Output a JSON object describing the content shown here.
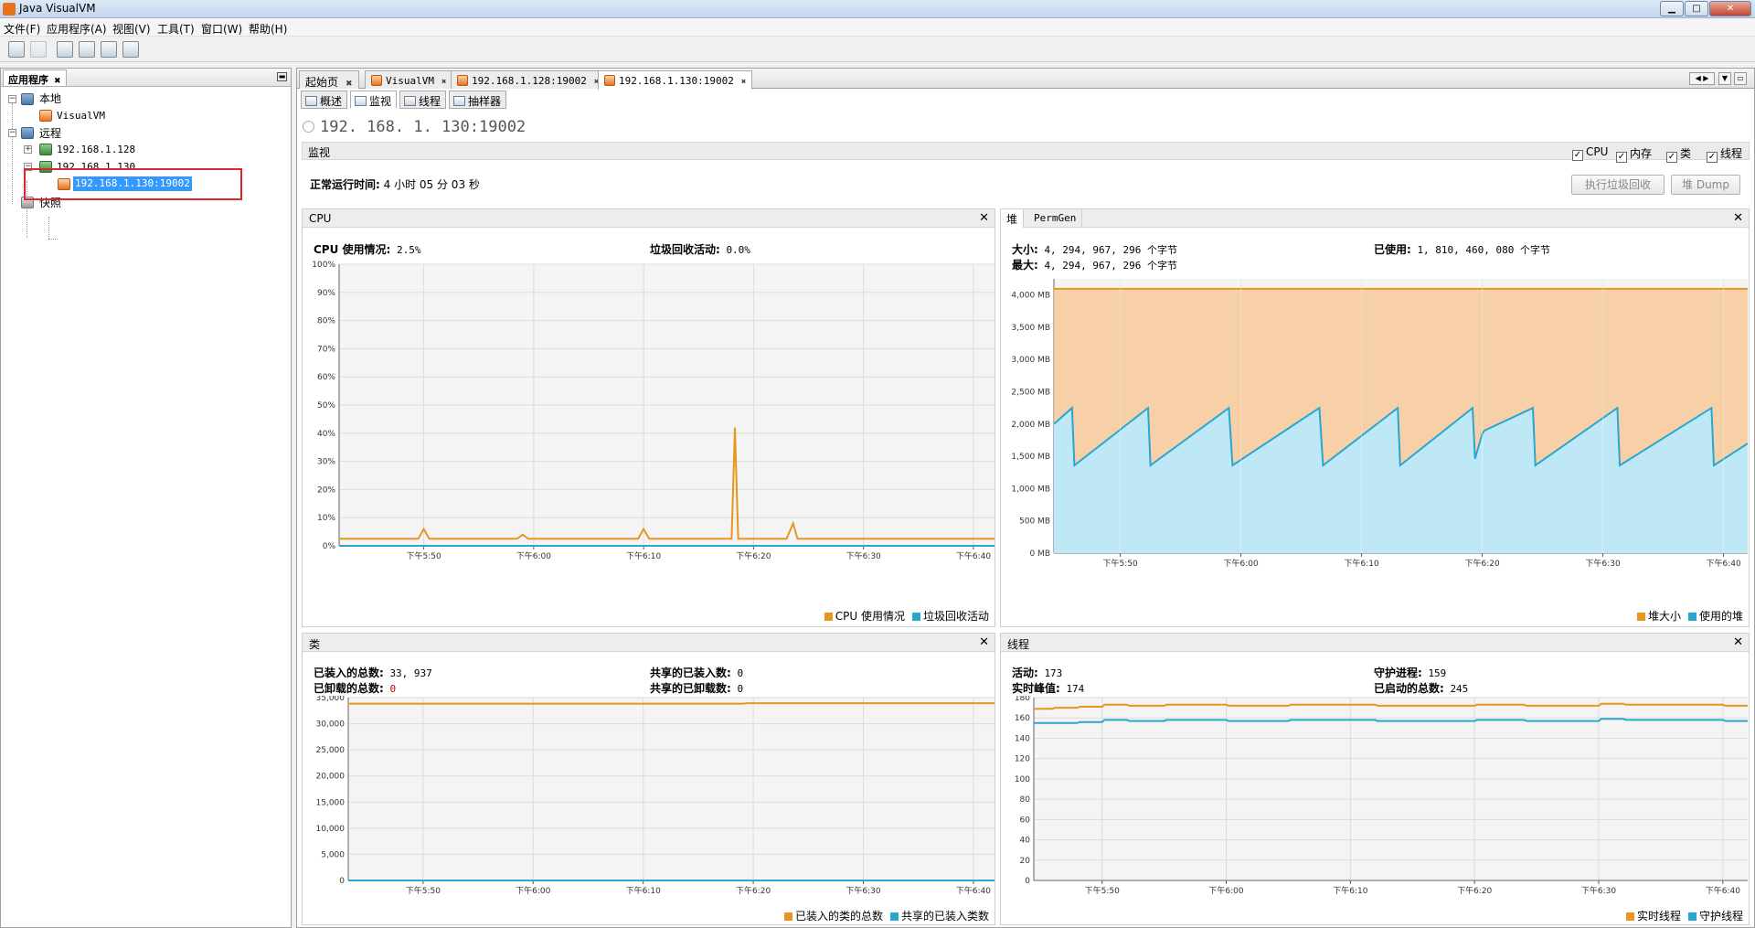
{
  "window": {
    "title": "Java VisualVM"
  },
  "menu": [
    "文件(F)",
    "应用程序(A)",
    "视图(V)",
    "工具(T)",
    "窗口(W)",
    "帮助(H)"
  ],
  "apps_panel": {
    "title": "应用程序",
    "local_label": "本地",
    "local_child": "VisualVM",
    "remote_label": "远程",
    "host1": "192.168.1.128",
    "host2": "192.168.1.130",
    "jmx": "192.168.1.130:19002",
    "snapshots_label": "快照"
  },
  "doc_tabs": [
    "起始页",
    "VisualVM",
    "192.168.1.128:19002",
    "192.168.1.130:19002"
  ],
  "sub_tabs": [
    "概述",
    "监视",
    "线程",
    "抽样器"
  ],
  "host_header": "192. 168. 1. 130:19002",
  "monitor": {
    "label": "监视",
    "checkboxes": [
      "CPU",
      "内存",
      "类",
      "线程"
    ],
    "uptime_label": "正常运行时间:",
    "uptime_value": "4 小时 05 分 03 秒",
    "gc_button": "执行垃圾回收",
    "dump_button": "堆 Dump"
  },
  "cpu": {
    "title": "CPU",
    "usage_label": "CPU 使用情况:",
    "usage_value": "2.5%",
    "gc_label": "垃圾回收活动:",
    "gc_value": "0.0%",
    "legend": [
      "CPU 使用情况",
      "垃圾回收活动"
    ]
  },
  "heap": {
    "tab_heap": "堆",
    "tab_perm": "PermGen",
    "size_label": "大小:",
    "size_value": "4, 294, 967, 296 个字节",
    "max_label": "最大:",
    "max_value": "4, 294, 967, 296 个字节",
    "used_label": "已使用:",
    "used_value": "1, 810, 460, 080 个字节",
    "legend": [
      "堆大小",
      "使用的堆"
    ]
  },
  "classes": {
    "title": "类",
    "loaded_label": "已装入的总数:",
    "loaded_value": "33, 937",
    "unloaded_label": "已卸载的总数:",
    "unloaded_value": "0",
    "shared_loaded_label": "共享的已装入数:",
    "shared_loaded_value": "0",
    "shared_unloaded_label": "共享的已卸载数:",
    "shared_unloaded_value": "0",
    "legend": [
      "已装入的类的总数",
      "共享的已装入类数"
    ]
  },
  "threads": {
    "title": "线程",
    "live_label": "活动:",
    "live_value": "173",
    "peak_label": "实时峰值:",
    "peak_value": "174",
    "daemon_label": "守护进程:",
    "daemon_value": "159",
    "started_label": "已启动的总数:",
    "started_value": "245",
    "legend": [
      "实时线程",
      "守护线程"
    ]
  },
  "colors": {
    "orange": "#e8961f",
    "blue": "#2aa6d0",
    "heap_fill": "#f7c99a",
    "used_fill": "#bfe8f7"
  },
  "chart_data": [
    {
      "type": "line",
      "title": "CPU",
      "x_ticks": [
        "下午5:50",
        "下午6:00",
        "下午6:10",
        "下午6:20",
        "下午6:30",
        "下午6:40"
      ],
      "x_tick_minutes": [
        50,
        60,
        70,
        80,
        90,
        100
      ],
      "x_range": [
        42.3,
        102
      ],
      "y_ticks": [
        "0%",
        "10%",
        "20%",
        "30%",
        "40%",
        "50%",
        "60%",
        "70%",
        "80%",
        "90%",
        "100%"
      ],
      "ylim": [
        0,
        100
      ],
      "series": [
        {
          "name": "CPU 使用情况",
          "color": "#e8961f",
          "x": [
            42.3,
            45,
            49.5,
            50,
            50.5,
            55,
            58.5,
            59,
            59.5,
            66,
            69.5,
            70,
            70.5,
            78,
            78.3,
            78.6,
            79,
            83,
            83.6,
            84,
            85,
            90,
            95,
            100,
            102
          ],
          "values": [
            2.5,
            2.5,
            2.5,
            6,
            2.5,
            2.5,
            2.5,
            4,
            2.5,
            2.5,
            2.5,
            6,
            2.5,
            2.5,
            42,
            2.5,
            2.5,
            2.5,
            8,
            2.5,
            2.5,
            2.5,
            2.5,
            2.5,
            2.5
          ]
        },
        {
          "name": "垃圾回收活动",
          "color": "#2aa6d0",
          "x": [
            42.3,
            102
          ],
          "values": [
            0,
            0
          ]
        }
      ]
    },
    {
      "type": "area",
      "title": "堆",
      "x_ticks": [
        "下午5:50",
        "下午6:00",
        "下午6:10",
        "下午6:20",
        "下午6:30",
        "下午6:40"
      ],
      "x_tick_minutes": [
        50,
        60,
        70,
        80,
        90,
        100
      ],
      "x_range": [
        44.5,
        102
      ],
      "y_ticks": [
        "0 MB",
        "500 MB",
        "1,000 MB",
        "1,500 MB",
        "2,000 MB",
        "2,500 MB",
        "3,000 MB",
        "3,500 MB",
        "4,000 MB"
      ],
      "ylim": [
        0,
        4250
      ],
      "series": [
        {
          "name": "堆大小",
          "color": "#e8961f",
          "x": [
            44.5,
            102
          ],
          "values": [
            4096,
            4096
          ]
        },
        {
          "name": "使用的堆",
          "color": "#2aa6d0",
          "x": [
            44.5,
            46,
            46.2,
            52.3,
            52.5,
            59,
            59.3,
            66.5,
            66.8,
            73,
            73.2,
            79.2,
            79.4,
            80,
            80.2,
            84.2,
            84.4,
            91.2,
            91.4,
            99,
            99.2,
            102
          ],
          "values": [
            2000,
            2250,
            1360,
            2250,
            1360,
            2250,
            1360,
            2250,
            1360,
            2250,
            1360,
            2250,
            1460,
            1850,
            1900,
            2250,
            1360,
            2250,
            1360,
            2250,
            1360,
            1700
          ]
        }
      ]
    },
    {
      "type": "line",
      "title": "类",
      "x_ticks": [
        "下午5:50",
        "下午6:00",
        "下午6:10",
        "下午6:20",
        "下午6:30",
        "下午6:40"
      ],
      "x_tick_minutes": [
        50,
        60,
        70,
        80,
        90,
        100
      ],
      "x_range": [
        43.2,
        102
      ],
      "y_ticks": [
        "0",
        "5,000",
        "10,000",
        "15,000",
        "20,000",
        "25,000",
        "30,000",
        "35,000"
      ],
      "ylim": [
        0,
        35000
      ],
      "series": [
        {
          "name": "已装入的类的总数",
          "color": "#e8961f",
          "x": [
            43.2,
            79,
            79.5,
            102
          ],
          "values": [
            33850,
            33850,
            33937,
            33937
          ]
        },
        {
          "name": "共享的已装入类数",
          "color": "#2aa6d0",
          "x": [
            43.2,
            102
          ],
          "values": [
            0,
            0
          ]
        }
      ]
    },
    {
      "type": "line",
      "title": "线程",
      "x_ticks": [
        "下午5:50",
        "下午6:00",
        "下午6:10",
        "下午6:20",
        "下午6:30",
        "下午6:40"
      ],
      "x_tick_minutes": [
        50,
        60,
        70,
        80,
        90,
        100
      ],
      "x_range": [
        44.5,
        102
      ],
      "y_ticks": [
        "0",
        "20",
        "40",
        "60",
        "80",
        "100",
        "120",
        "140",
        "160",
        "180"
      ],
      "ylim": [
        0,
        180
      ],
      "series": [
        {
          "name": "实时线程",
          "color": "#e8961f",
          "x": [
            44.5,
            46,
            46.2,
            48,
            48.2,
            50,
            50.2,
            52,
            52.2,
            55,
            55.2,
            60,
            60.2,
            65,
            65.2,
            72,
            72.2,
            80,
            80.2,
            84,
            84.2,
            90,
            90.2,
            92,
            92.2,
            100,
            100.2,
            102
          ],
          "values": [
            169,
            169,
            170,
            170,
            171,
            171,
            173,
            173,
            172,
            172,
            173,
            173,
            172,
            172,
            173,
            173,
            172,
            172,
            173,
            173,
            172,
            172,
            174,
            174,
            173,
            173,
            172,
            172
          ]
        },
        {
          "name": "守护线程",
          "color": "#2aa6d0",
          "x": [
            44.5,
            48,
            48.2,
            50,
            50.2,
            52,
            52.2,
            55,
            55.2,
            60,
            60.2,
            65,
            65.2,
            72,
            72.2,
            80,
            80.2,
            84,
            84.2,
            90,
            90.2,
            92,
            92.2,
            100,
            100.2,
            102
          ],
          "values": [
            155,
            155,
            156,
            156,
            158,
            158,
            157,
            157,
            158,
            158,
            157,
            157,
            158,
            158,
            157,
            157,
            158,
            158,
            157,
            157,
            159,
            159,
            158,
            158,
            157,
            157
          ]
        }
      ]
    }
  ]
}
